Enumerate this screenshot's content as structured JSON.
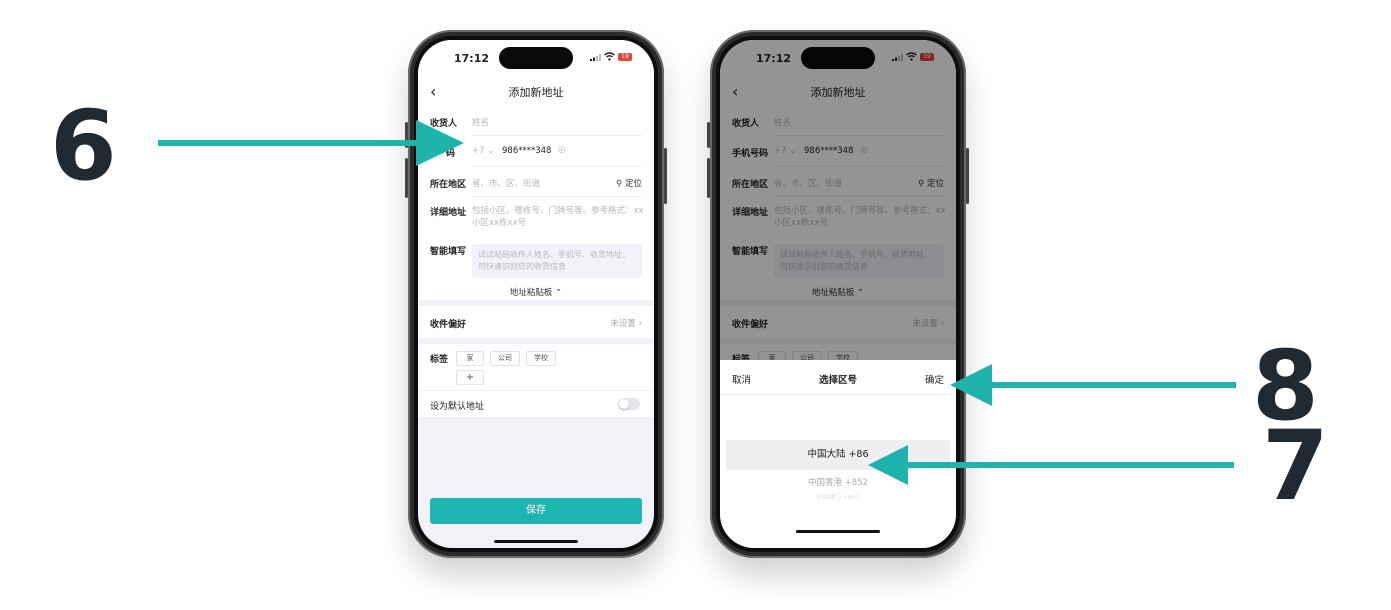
{
  "steps": {
    "step6": "6",
    "step7": "7",
    "step8": "8"
  },
  "colors": {
    "accent": "#1db5b0",
    "step_number": "#1f2a33",
    "arrow": "#1fb3ae"
  },
  "status": {
    "time": "17:12",
    "battery": "19"
  },
  "page": {
    "title": "添加新地址",
    "back_icon": "chevron-left-icon"
  },
  "form": {
    "recipient_label": "收货人",
    "recipient_placeholder": "姓名",
    "phone_label": "手机号码",
    "phone_label_partial": "码",
    "country_code": "+7",
    "phone_value": "986****348",
    "region_label": "所在地区",
    "region_placeholder": "省、市、区、街道",
    "locate_label": "定位",
    "detail_label": "详细地址",
    "detail_placeholder_1": "包括小区、楼栋号、门牌号等。参考格式：xx",
    "detail_placeholder_2": "小区xx栋xx号",
    "smart_label": "智能填写",
    "smart_placeholder_1": "试试粘贴收件人姓名、手机号、收货地址，",
    "smart_placeholder_2": "可快速识别您的收货信息",
    "clipboard_label": "地址粘贴板"
  },
  "preference": {
    "label": "收件偏好",
    "value": "未设置"
  },
  "tags": {
    "label": "标签",
    "items": [
      "家",
      "公司",
      "学校"
    ],
    "add": "+"
  },
  "default": {
    "label": "设为默认地址",
    "on": false
  },
  "save": {
    "label": "保存"
  },
  "picker": {
    "cancel": "取消",
    "title": "选择区号",
    "confirm": "确定",
    "options": [
      "中国大陆 +86",
      "中国香港 +852",
      "中国澳门 +853"
    ],
    "selected_index": 0
  }
}
